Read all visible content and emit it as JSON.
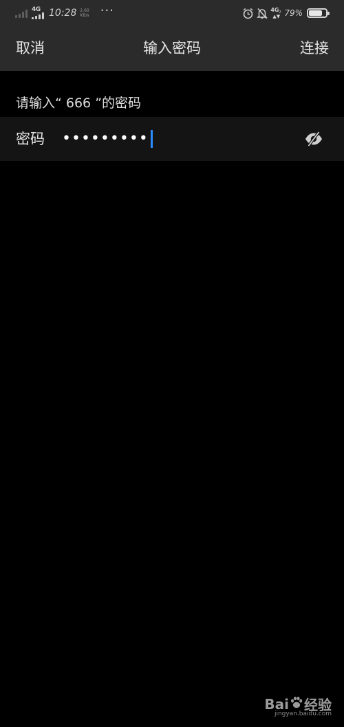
{
  "status_bar": {
    "network_type": "4G",
    "time": "10:28",
    "speed_value": "2.60",
    "speed_unit": "KB/s",
    "more_dots": "···",
    "network_type_right": "4G",
    "network_sub": "2",
    "battery_percent": "79%",
    "battery_level": 0.79,
    "icons": [
      "signal-icon",
      "alarm-icon",
      "notifications-off-icon",
      "battery-icon"
    ]
  },
  "title_bar": {
    "cancel_label": "取消",
    "title": "输入密码",
    "connect_label": "连接"
  },
  "content": {
    "prompt": "请输入“ 666 ”的密码",
    "password_label": "密码",
    "password_masked": "•••••••••",
    "visibility_icon": "eye-off-icon",
    "accent_color": "#2a8cff"
  },
  "watermark": {
    "brand_left": "Bai",
    "brand_right": "经验",
    "url": "jingyan.baidu.com"
  }
}
